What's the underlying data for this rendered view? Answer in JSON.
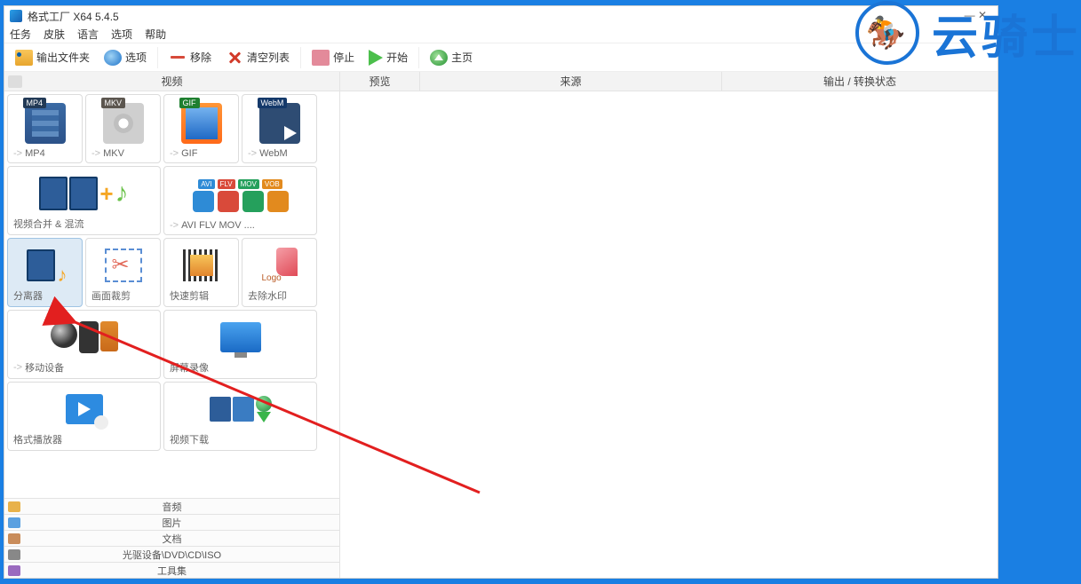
{
  "watermark": "云骑士",
  "window": {
    "title": "格式工厂 X64 5.4.5"
  },
  "menu": {
    "task": "任务",
    "skin": "皮肤",
    "language": "语言",
    "options": "选项",
    "help": "帮助"
  },
  "toolbar": {
    "output_folder": "输出文件夹",
    "options": "选项",
    "remove": "移除",
    "clear_list": "清空列表",
    "stop": "停止",
    "start": "开始",
    "home": "主页"
  },
  "left": {
    "active_category": "视频",
    "formats": {
      "mp4": "MP4",
      "mkv": "MKV",
      "gif": "GIF",
      "webm": "WebM"
    },
    "merge": "视频合并 & 混流",
    "multi": "AVI FLV MOV ....",
    "multi_badges": {
      "avi": "AVI",
      "flv": "FLV",
      "mov": "MOV",
      "vob": "VOB"
    },
    "splitter": "分离器",
    "crop": "画面裁剪",
    "quick_clip": "快速剪辑",
    "remove_wm": "去除水印",
    "mobile": "移动设备",
    "screen_rec": "屏幕录像",
    "player": "格式播放器",
    "video_dl": "视频下载",
    "categories": {
      "audio": "音频",
      "image": "图片",
      "doc": "文档",
      "disc": "光驱设备\\DVD\\CD\\ISO",
      "toolkit": "工具集"
    }
  },
  "list_headers": {
    "preview": "预览",
    "source": "来源",
    "status": "输出 / 转换状态"
  }
}
